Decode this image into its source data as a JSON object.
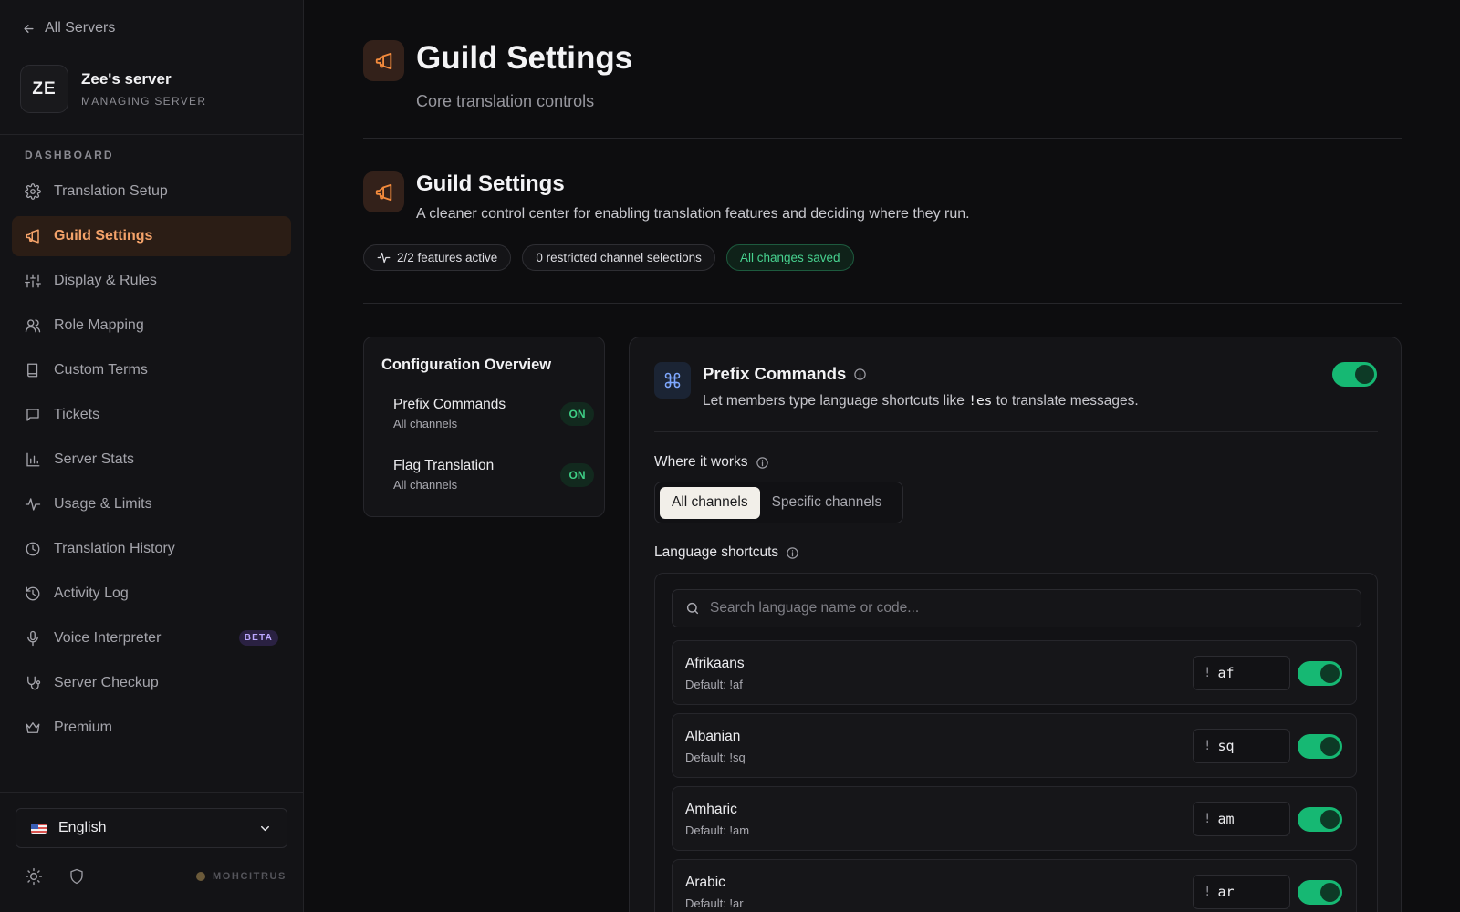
{
  "sidebar": {
    "back_label": "All Servers",
    "server": {
      "initials": "ZE",
      "name": "Zee's server",
      "subtitle": "MANAGING SERVER"
    },
    "section_label": "DASHBOARD",
    "items": [
      {
        "label": "Translation Setup",
        "icon": "gear-icon"
      },
      {
        "label": "Guild Settings",
        "icon": "megaphone-icon",
        "active": true
      },
      {
        "label": "Display & Rules",
        "icon": "sliders-icon"
      },
      {
        "label": "Role Mapping",
        "icon": "users-icon"
      },
      {
        "label": "Custom Terms",
        "icon": "book-icon"
      },
      {
        "label": "Tickets",
        "icon": "message-icon"
      },
      {
        "label": "Server Stats",
        "icon": "bar-chart-icon"
      },
      {
        "label": "Usage & Limits",
        "icon": "activity-icon"
      },
      {
        "label": "Translation History",
        "icon": "clock-icon"
      },
      {
        "label": "Activity Log",
        "icon": "history-icon"
      },
      {
        "label": "Voice Interpreter",
        "icon": "mic-icon",
        "badge": "BETA"
      },
      {
        "label": "Server Checkup",
        "icon": "stethoscope-icon"
      },
      {
        "label": "Premium",
        "icon": "crown-icon"
      }
    ],
    "language_select": {
      "value": "English"
    },
    "brand": "MOHCITRUS"
  },
  "header": {
    "title": "Guild Settings",
    "subtitle": "Core translation controls"
  },
  "section": {
    "title": "Guild Settings",
    "description": "A cleaner control center for enabling translation features and deciding where they run.",
    "pills": {
      "features": "2/2 features active",
      "restricted": "0 restricted channel selections",
      "saved": "All changes saved"
    }
  },
  "overview": {
    "title": "Configuration Overview",
    "items": [
      {
        "name": "Prefix Commands",
        "scope": "All channels",
        "status": "ON"
      },
      {
        "name": "Flag Translation",
        "scope": "All channels",
        "status": "ON"
      }
    ]
  },
  "prefix": {
    "title": "Prefix Commands",
    "desc_before": "Let members type language shortcuts like ",
    "desc_code": "!es",
    "desc_after": " to translate messages.",
    "enabled": true,
    "where_label": "Where it works",
    "scope_options": [
      "All channels",
      "Specific channels"
    ],
    "scope_selected": "All channels",
    "shortcuts_label": "Language shortcuts",
    "search_placeholder": "Search language name or code...",
    "languages": [
      {
        "name": "Afrikaans",
        "default": "Default: !af",
        "prefix": "!",
        "code": "af",
        "enabled": true
      },
      {
        "name": "Albanian",
        "default": "Default: !sq",
        "prefix": "!",
        "code": "sq",
        "enabled": true
      },
      {
        "name": "Amharic",
        "default": "Default: !am",
        "prefix": "!",
        "code": "am",
        "enabled": true
      },
      {
        "name": "Arabic",
        "default": "Default: !ar",
        "prefix": "!",
        "code": "ar",
        "enabled": true
      }
    ]
  },
  "colors": {
    "accent": "#f5a36a",
    "toggle_on": "#16b873",
    "saved_green": "#47d18f"
  }
}
